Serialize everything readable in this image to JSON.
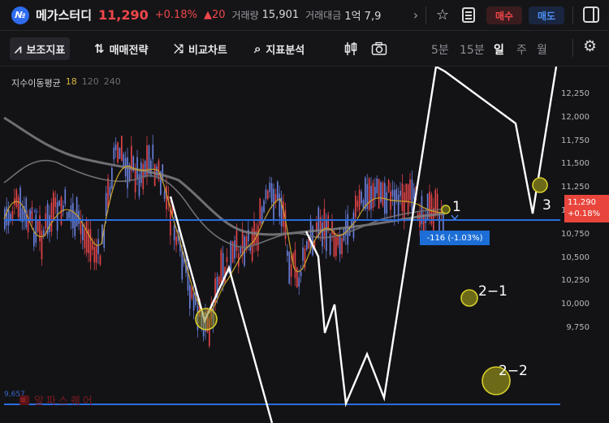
{
  "header": {
    "logo_text": "№",
    "stock_name": "메가스터디",
    "price": "11,290",
    "change_pct": "+0.18%",
    "change_abs": "▲20",
    "volume_label": "거래량",
    "volume_value": "15,901",
    "amount_label": "거래대금",
    "amount_value": "1억 7,9",
    "nav_icon": "chevron-right-icon",
    "buy_label": "매수",
    "sell_label": "매도"
  },
  "toolbar": {
    "indicator_label": "보조지표",
    "strategy_label": "매매전략",
    "compare_label": "비교차트",
    "analysis_label": "지표분석",
    "periods": [
      "5분",
      "15분",
      "일",
      "주",
      "월"
    ],
    "active_period": "일"
  },
  "chart_data": {
    "type": "candlestick",
    "ma_legend": {
      "title": "지수이동평균",
      "p1": "18",
      "p2": "120",
      "p3": "240"
    },
    "yaxis_ticks": [
      "12,250",
      "12,000",
      "11,750",
      "11,500",
      "11,250",
      "11,000",
      "10,750",
      "10,500",
      "10,250",
      "10,000",
      "9,750"
    ],
    "current_price": "11,290",
    "current_change": "+0.18%",
    "diff_label": "-116 (-1.03%)",
    "support_lines": [
      11176,
      9657
    ],
    "left_line_label_1": ".176",
    "left_line_label_2": "9,657",
    "annotations": [
      "1",
      "2−1",
      "2−2",
      "3"
    ],
    "colors": {
      "up": "#f0474a",
      "down": "#6f86e8",
      "ma18": "#c9a22e",
      "ma_long": "#8c8c8c",
      "support": "#2b6ee0",
      "draw": "#ffffff",
      "marker": "#d6cf2a"
    }
  },
  "watermark": {
    "text": "알파스퀘어",
    "icon": "α"
  }
}
